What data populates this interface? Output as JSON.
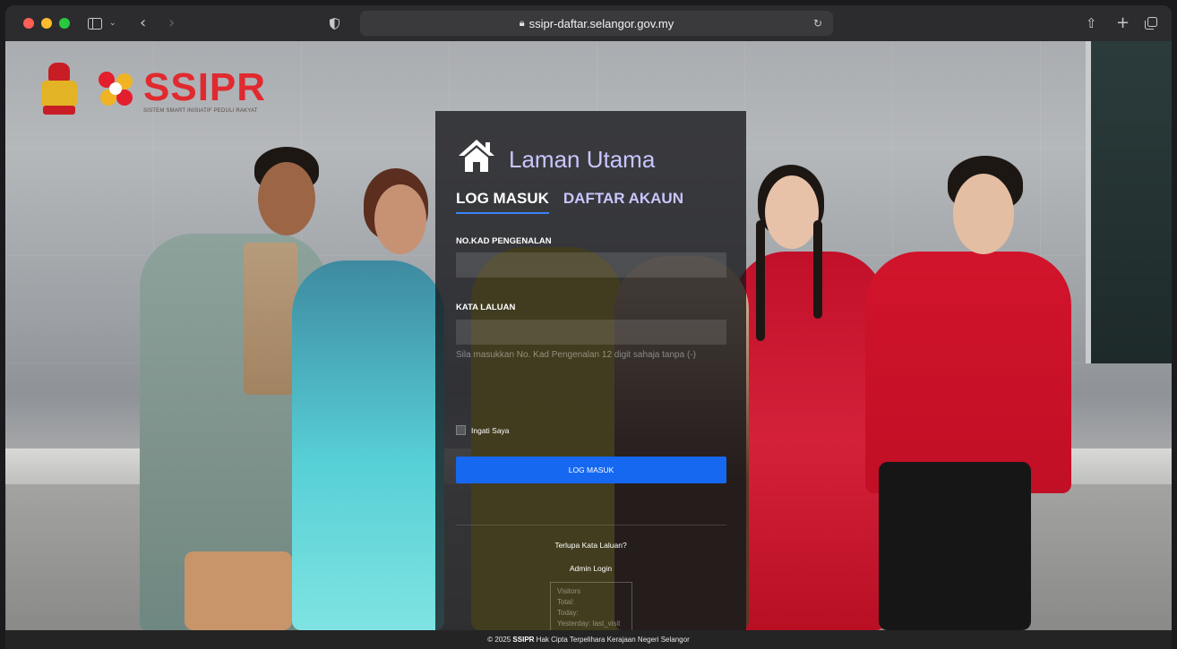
{
  "browser": {
    "url": "ssipr-daftar.selangor.gov.my",
    "icons": [
      "sidebar-icon",
      "chevron-down-icon",
      "back-icon",
      "forward-icon",
      "shield-icon",
      "lock-icon",
      "reload-icon",
      "share-icon",
      "new-tab-icon",
      "tabs-overview-icon"
    ]
  },
  "header": {
    "brand_name": "SSIPR",
    "brand_subtitle": "SISTEM SMART INISIATIF PEDULI RAKYAT"
  },
  "login": {
    "title": "Laman Utama",
    "tabs": [
      {
        "label": "LOG MASUK",
        "active": true
      },
      {
        "label": "DAFTAR AKAUN",
        "active": false
      }
    ],
    "ic_label": "NO.KAD PENGENALAN",
    "ic_value": "",
    "ic_hint": "Sila masukkan No. Kad Pengenalan 12 digit sahaja tanpa (-)",
    "password_label": "KATA LALUAN",
    "password_value": "",
    "remember_label": "Ingati Saya",
    "remember_checked": false,
    "submit_label": "LOG MASUK",
    "forgot_label": "Terlupa Kata Laluan?",
    "admin_label": "Admin Login",
    "visitors": {
      "title": "Visitors",
      "total": "Total:",
      "today": "Today:",
      "yesterday": "Yesterday: last_visit"
    }
  },
  "footer": {
    "prefix": "© 2025",
    "brand": "SSIPR",
    "text": "Hak Cipta Terpelihara Kerajaan Negeri Selangor"
  },
  "colors": {
    "accent": "#1668f0",
    "brand_red": "#e02a2f",
    "title_lavender": "#c9c6ff"
  }
}
